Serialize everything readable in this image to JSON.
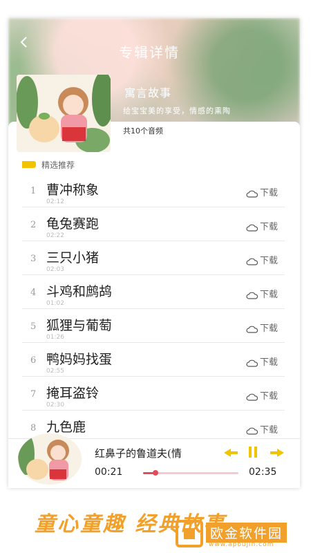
{
  "header": {
    "title": "专辑详情",
    "back_icon": "back-arrow-icon"
  },
  "album": {
    "title": "寓言故事",
    "description": "给宝宝美的享受，情感的熏陶",
    "count": "共10个音频"
  },
  "section": {
    "title": "精选推荐"
  },
  "tracks": [
    {
      "index": "1",
      "name": "曹冲称象",
      "meta": "02:12",
      "download": "下载"
    },
    {
      "index": "2",
      "name": "龟兔赛跑",
      "meta": "02:22",
      "download": "下载"
    },
    {
      "index": "3",
      "name": "三只小猪",
      "meta": "02:03",
      "download": "下载"
    },
    {
      "index": "4",
      "name": "斗鸡和鹧鸪",
      "meta": "01:02",
      "download": "下载"
    },
    {
      "index": "5",
      "name": "狐狸与葡萄",
      "meta": "01:26",
      "download": "下载"
    },
    {
      "index": "6",
      "name": "鸭妈妈找蛋",
      "meta": "02:55",
      "download": "下载"
    },
    {
      "index": "7",
      "name": "掩耳盗铃",
      "meta": "02:30",
      "download": "下载"
    },
    {
      "index": "8",
      "name": "九色鹿",
      "meta": "",
      "download": "下载"
    }
  ],
  "player": {
    "title": "红鼻子的鲁道夫(情",
    "current_time": "00:21",
    "total_time": "02:35",
    "progress_fraction": 0.13
  },
  "banner": {
    "slogan": "童心童趣 经典故事",
    "brand_name": "欧金软件园",
    "brand_url": "www.apoujin.com"
  },
  "colors": {
    "accent": "#f1a12b",
    "progress": "#e44c5d",
    "flag": "#f2c300"
  }
}
